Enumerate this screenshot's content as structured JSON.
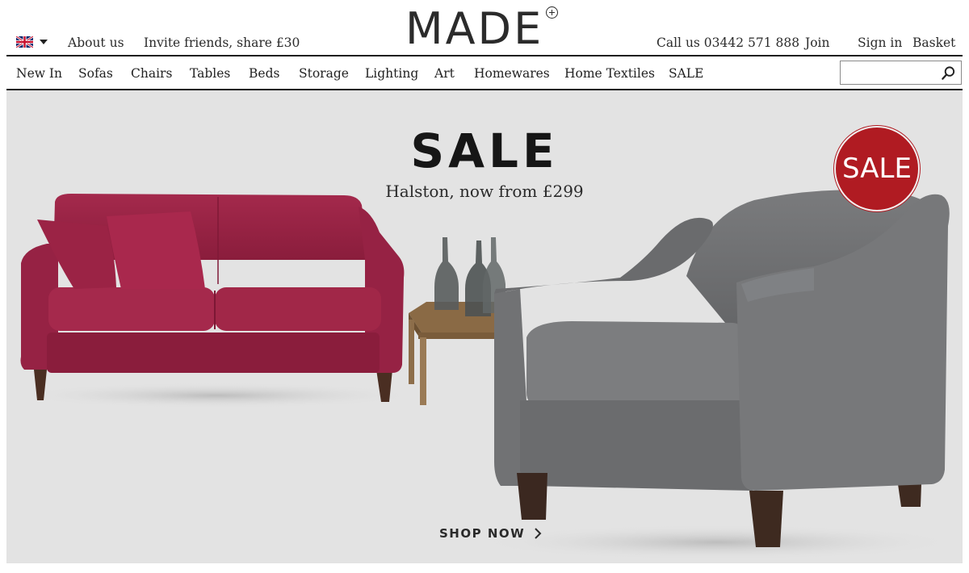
{
  "brand": {
    "logo_text": "MADE"
  },
  "header": {
    "country_flag_icon": "uk-flag-icon",
    "about": "About us",
    "invite": "Invite friends, share £30",
    "call": "Call us 03442 571 888",
    "join": "Join",
    "signin": "Sign in",
    "basket": "Basket"
  },
  "nav": {
    "items": [
      "New In",
      "Sofas",
      "Chairs",
      "Tables",
      "Beds",
      "Storage",
      "Lighting",
      "Art",
      "Homewares",
      "Home Textiles",
      "SALE"
    ],
    "search": {
      "value": "",
      "placeholder": "",
      "icon": "search-icon"
    }
  },
  "hero": {
    "title": "SALE",
    "subtitle": "Halston, now from £299",
    "badge": "SALE",
    "cta": "SHOP NOW",
    "colors": {
      "background": "#e3e3e3",
      "badge": "#b01b22",
      "sofa": "#9e2446",
      "armchair": "#6f7072"
    }
  }
}
